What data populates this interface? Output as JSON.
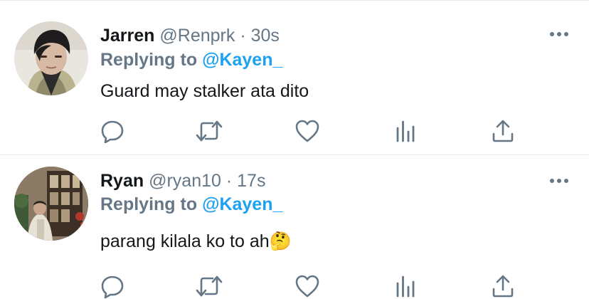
{
  "tweets": [
    {
      "display_name": "Jarren",
      "handle": "@Renprk",
      "separator": "·",
      "time": "30s",
      "replying_prefix": "Replying to",
      "replying_to": "@Kayen_",
      "text": "Guard may stalker ata dito",
      "avatar_icon": "avatar-photo"
    },
    {
      "display_name": "Ryan",
      "handle": "@ryan10",
      "separator": "·",
      "time": "17s",
      "replying_prefix": "Replying to",
      "replying_to": "@Kayen_",
      "text": "parang kilala ko to ah🤔",
      "avatar_icon": "avatar-photo"
    }
  ],
  "actions": [
    "reply-icon",
    "retweet-icon",
    "like-icon",
    "analytics-icon",
    "share-icon"
  ],
  "colors": {
    "text_primary": "#14171a",
    "text_secondary": "#657786",
    "accent": "#1da1f2",
    "divider": "#e6ecf0"
  }
}
